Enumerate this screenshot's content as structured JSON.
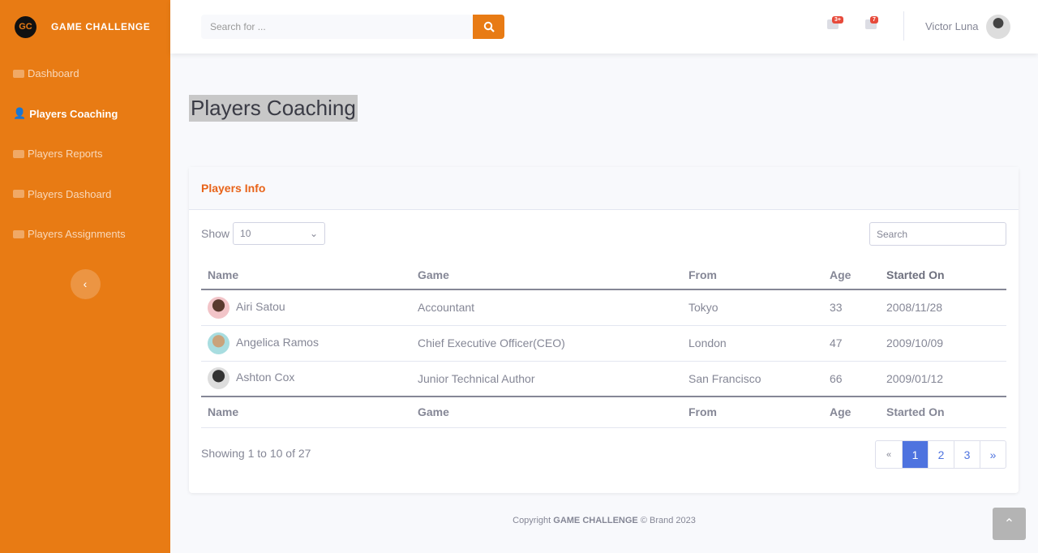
{
  "brand": {
    "logo": "GC",
    "name": "GAME CHALLENGE"
  },
  "sidebar": {
    "items": [
      {
        "label": "Dashboard"
      },
      {
        "label": "Players Coaching"
      },
      {
        "label": "Players Reports"
      },
      {
        "label": "Players Dashoard"
      },
      {
        "label": "Players Assignments"
      }
    ],
    "toggle": "‹"
  },
  "topbar": {
    "search_placeholder": "Search for ...",
    "alerts_badge": "3+",
    "messages_badge": "7",
    "user": "Victor Luna"
  },
  "page": {
    "title": "Players Coaching"
  },
  "card": {
    "title": "Players Info",
    "show_label": "Show",
    "show_value": "10",
    "search_placeholder": "Search",
    "columns": [
      "Name",
      "Game",
      "From",
      "Age",
      "Started On"
    ],
    "rows": [
      {
        "name": "Airi Satou",
        "game": "Accountant",
        "from": "Tokyo",
        "age": "33",
        "started": "2008/11/28"
      },
      {
        "name": "Angelica Ramos",
        "game": "Chief Executive Officer(CEO)",
        "from": "London",
        "age": "47",
        "started": "2009/10/09"
      },
      {
        "name": "Ashton Cox",
        "game": "Junior Technical Author",
        "from": "San Francisco",
        "age": "66",
        "started": "2009/01/12"
      }
    ],
    "info": "Showing 1 to 10 of 27",
    "pager": [
      "«",
      "1",
      "2",
      "3",
      "»"
    ]
  },
  "footer": {
    "prefix": "Copyright ",
    "brand": "GAME CHALLENGE",
    "suffix": " © Brand 2023"
  }
}
